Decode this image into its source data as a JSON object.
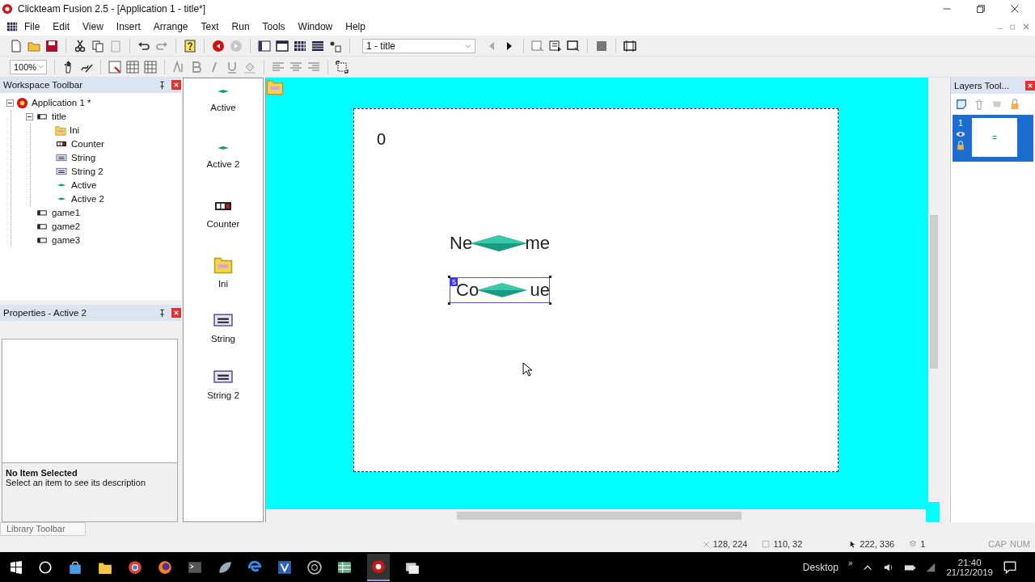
{
  "window": {
    "title": "Clickteam Fusion 2.5 - [Application 1 - title*]"
  },
  "menu": [
    "File",
    "Edit",
    "View",
    "Insert",
    "Arrange",
    "Text",
    "Run",
    "Tools",
    "Window",
    "Help"
  ],
  "toolbar": {
    "frame_select": "1 - title",
    "zoom": "100%"
  },
  "workspace": {
    "title": "Workspace Toolbar",
    "tree": [
      {
        "label": "Application 1 *",
        "kind": "app",
        "expanded": true,
        "children": [
          {
            "label": "title",
            "kind": "frame",
            "expanded": true,
            "children": [
              {
                "label": "Ini",
                "kind": "ini"
              },
              {
                "label": "Counter",
                "kind": "counter"
              },
              {
                "label": "String",
                "kind": "string"
              },
              {
                "label": "String 2",
                "kind": "string"
              },
              {
                "label": "Active",
                "kind": "active"
              },
              {
                "label": "Active 2",
                "kind": "active"
              }
            ]
          },
          {
            "label": "game1",
            "kind": "frame"
          },
          {
            "label": "game2",
            "kind": "frame"
          },
          {
            "label": "game3",
            "kind": "frame"
          }
        ]
      }
    ]
  },
  "properties": {
    "title": "Properties - Active 2",
    "description_title": "No Item Selected",
    "description": "Select an item to see its description"
  },
  "objects": [
    {
      "label": "Active",
      "kind": "active"
    },
    {
      "label": "Active 2",
      "kind": "active"
    },
    {
      "label": "Counter",
      "kind": "counter"
    },
    {
      "label": "Ini",
      "kind": "ini"
    },
    {
      "label": "String",
      "kind": "string"
    },
    {
      "label": "String 2",
      "kind": "string"
    }
  ],
  "canvas": {
    "counter": "0",
    "strings": [
      {
        "before": "Ne",
        "after": "me",
        "selected": false
      },
      {
        "before": "Co",
        "after": "ue",
        "selected": true,
        "badge": "5"
      }
    ]
  },
  "layers": {
    "title": "Layers Tool...",
    "items": [
      {
        "number": "1",
        "selected": true
      }
    ]
  },
  "library_tab": "Library Toolbar",
  "status": {
    "cursor": "128, 224",
    "size": "110, 32",
    "position": "222, 336",
    "layer": "1",
    "caps": "CAP",
    "num": "NUM"
  },
  "taskbar": {
    "desktop": "Desktop",
    "chevron": "»",
    "time": "21:40",
    "date": "21/12/2019"
  }
}
